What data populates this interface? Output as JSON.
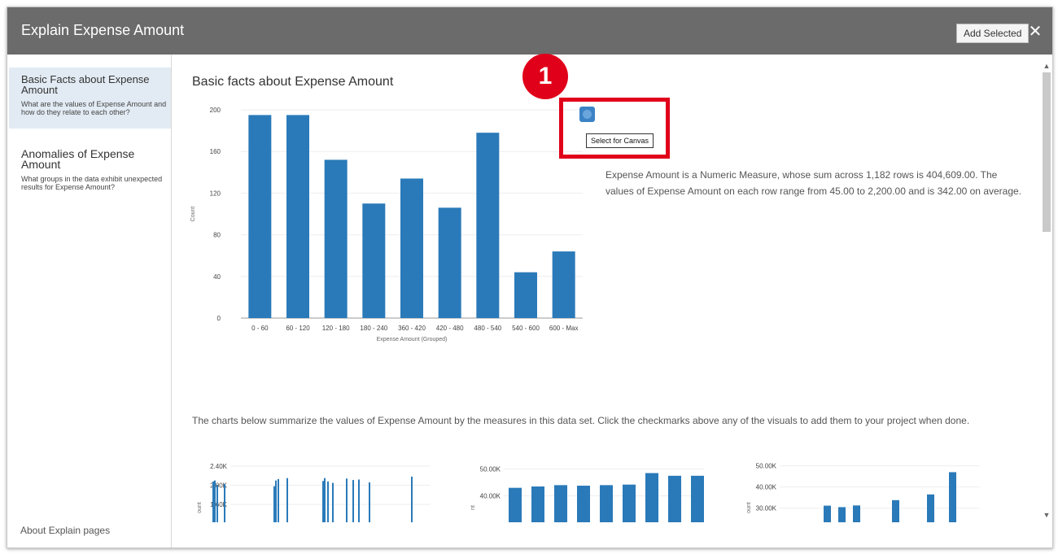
{
  "dialog": {
    "title": "Explain Expense Amount",
    "add_selected": "Add Selected",
    "close_glyph": "✕",
    "accent": "#2a7ab9",
    "header_color": "#6b6b6b"
  },
  "sidebar": {
    "items": [
      {
        "title": "Basic Facts about Expense Amount",
        "desc": "What are the values of Expense Amount and how do they relate to each other?"
      },
      {
        "title": "Anomalies of Expense Amount",
        "desc": "What groups in the data exhibit unexpected results for Expense Amount?"
      }
    ],
    "about": "About Explain pages"
  },
  "main": {
    "section_title": "Basic facts about Expense Amount",
    "tooltip": "Select for Canvas",
    "callout_number": "1",
    "description": "Expense Amount is a Numeric Measure, whose sum across 1,182 rows is 404,609.00. The values of Expense Amount on each row range from 45.00 to 2,200.00 and is 342.00 on average.",
    "summary": "The charts below summarize the values of Expense Amount by the measures in this data set. Click the checkmarks above any of the visuals to add them to your project when done."
  },
  "chart_data": [
    {
      "type": "bar",
      "categories": [
        "0 - 60",
        "60 - 120",
        "120 - 180",
        "180 - 240",
        "360 - 420",
        "420 - 480",
        "480 - 540",
        "540 - 600",
        "600 - Max"
      ],
      "values": [
        195,
        195,
        152,
        110,
        134,
        106,
        178,
        44,
        64
      ],
      "xlabel": "Expense Amount (Grouped)",
      "ylabel": "Count",
      "ylim": [
        0,
        200
      ],
      "yticks": [
        "200",
        "160",
        "120",
        "80",
        "40",
        "0"
      ],
      "grid": true
    },
    {
      "type": "bar",
      "yticks": [
        "2.40K",
        "2.00K",
        "1.60K"
      ],
      "ylabel": "ount",
      "ylim": [
        1500,
        2450
      ],
      "values": [
        2080,
        2100,
        2010,
        2030,
        1980,
        2100,
        2130,
        2150,
        2090,
        2150,
        2080,
        2050,
        2140,
        2110,
        2120,
        2060,
        2180
      ]
    },
    {
      "type": "bar",
      "yticks": [
        "50.00K",
        "40.00K"
      ],
      "ylabel": "nt",
      "ylim": [
        35000,
        52000
      ],
      "values": [
        43000,
        43500,
        44000,
        43800,
        44000,
        44200,
        48500,
        47500,
        47500
      ]
    },
    {
      "type": "bar",
      "yticks": [
        "50.00K",
        "40.00K",
        "30.00K"
      ],
      "ylabel": "ount",
      "ylim": [
        29500,
        51000
      ],
      "values": [
        31200,
        30500,
        31300,
        33800,
        36500,
        47000
      ]
    }
  ]
}
